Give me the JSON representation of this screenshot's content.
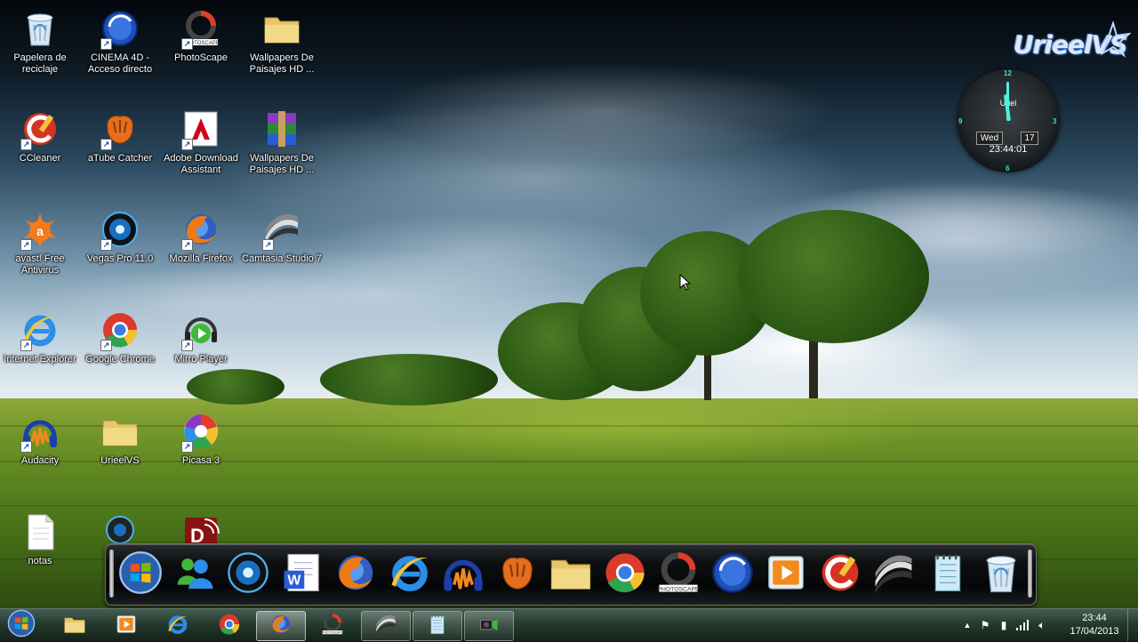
{
  "desktop": {
    "icons": [
      {
        "label": "Papelera de reciclaje",
        "icon": "recycle-bin-icon",
        "shortcut": false
      },
      {
        "label": "CINEMA 4D - Acceso directo",
        "icon": "cinema4d-icon",
        "shortcut": true
      },
      {
        "label": "PhotoScape",
        "icon": "photoscape-icon",
        "shortcut": true
      },
      {
        "label": "Wallpapers De Paisajes HD ...",
        "icon": "folder-icon",
        "shortcut": false
      },
      {
        "label": "CCleaner",
        "icon": "ccleaner-icon",
        "shortcut": true
      },
      {
        "label": "aTube Catcher",
        "icon": "atube-catcher-icon",
        "shortcut": true
      },
      {
        "label": "Adobe Download Assistant",
        "icon": "adobe-icon",
        "shortcut": true
      },
      {
        "label": "Wallpapers De Paisajes HD ...",
        "icon": "winrar-archive-icon",
        "shortcut": false
      },
      {
        "label": "avast! Free Antivirus",
        "icon": "avast-icon",
        "shortcut": true
      },
      {
        "label": "Vegas Pro 11.0",
        "icon": "vegas-pro-icon",
        "shortcut": true
      },
      {
        "label": "Mozilla Firefox",
        "icon": "firefox-icon",
        "shortcut": true
      },
      {
        "label": "Camtasia Studio 7",
        "icon": "camtasia-icon",
        "shortcut": true
      },
      {
        "label": "Internet Explorer",
        "icon": "internet-explorer-icon",
        "shortcut": true
      },
      {
        "label": "Google Chrome",
        "icon": "chrome-icon",
        "shortcut": true
      },
      {
        "label": "Mirro Player",
        "icon": "mirro-player-icon",
        "shortcut": true
      },
      {
        "label": "Audacity",
        "icon": "audacity-icon",
        "shortcut": true
      },
      {
        "label": "UrieelVS",
        "icon": "folder-icon",
        "shortcut": false
      },
      {
        "label": "Picasa 3",
        "icon": "picasa-icon",
        "shortcut": true
      },
      {
        "label": "notas",
        "icon": "text-document-icon",
        "shortcut": false
      },
      {
        "label": "",
        "icon": "webcam-icon",
        "shortcut": false
      },
      {
        "label": "",
        "icon": "red-app-icon",
        "shortcut": false
      }
    ]
  },
  "logo": {
    "text": "UrieelVS"
  },
  "clock_gadget": {
    "name": "Uriel",
    "day": "Wed",
    "date": "17",
    "time": "23:44:01",
    "numerals": [
      "12",
      "3",
      "6",
      "9"
    ]
  },
  "dock": {
    "items": [
      "windows-start-icon",
      "messenger-icon",
      "vegas-pro-icon",
      "word-icon",
      "firefox-icon",
      "internet-explorer-icon",
      "audacity-icon",
      "atube-catcher-icon",
      "folder-icon",
      "chrome-icon",
      "photoscape-icon",
      "cinema4d-icon",
      "media-player-icon",
      "ccleaner-icon",
      "camtasia-icon",
      "notepad-icon",
      "recycle-bin-icon"
    ]
  },
  "taskbar": {
    "pinned": [
      {
        "icon": "folder-icon",
        "state": "pinned"
      },
      {
        "icon": "media-player-icon",
        "state": "pinned"
      },
      {
        "icon": "internet-explorer-icon",
        "state": "pinned"
      },
      {
        "icon": "chrome-icon",
        "state": "pinned"
      },
      {
        "icon": "firefox-icon",
        "state": "active"
      },
      {
        "icon": "photoscape-icon",
        "state": "pinned"
      },
      {
        "icon": "camtasia-icon",
        "state": "open"
      },
      {
        "icon": "notepad-icon",
        "state": "open"
      },
      {
        "icon": "recorder-icon",
        "state": "open"
      }
    ],
    "time": "23:44",
    "date": "17/04/2013"
  },
  "colors": {
    "accent_teal": "#3ce0d0",
    "taskbar": "#2a4036"
  }
}
